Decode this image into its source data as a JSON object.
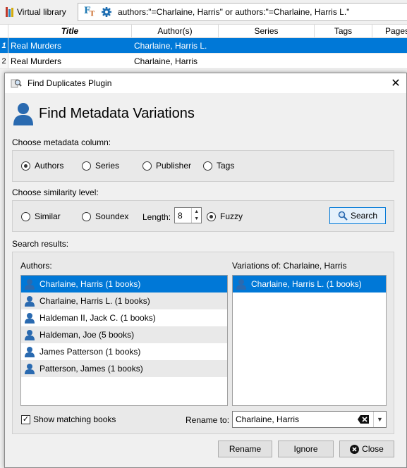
{
  "toolbar": {
    "virtual_library_label": "Virtual library",
    "search_text": "authors:\"=Charlaine, Harris\" or authors:\"=Charlaine, Harris L.\"",
    "ft_icon_main": "F",
    "ft_icon_sub": "T"
  },
  "table": {
    "headers": {
      "title": "Title",
      "authors": "Author(s)",
      "series": "Series",
      "tags": "Tags",
      "pages": "Pages"
    },
    "rows": [
      {
        "num": "1",
        "title": "Real Murders",
        "authors": "Charlaine, Harris L."
      },
      {
        "num": "2",
        "title": "Real Murders",
        "authors": "Charlaine, Harris"
      }
    ]
  },
  "dialog": {
    "window_title": "Find Duplicates Plugin",
    "heading": "Find Metadata Variations",
    "metadata_column_label": "Choose metadata column:",
    "columns": {
      "authors": "Authors",
      "series": "Series",
      "publisher": "Publisher",
      "tags": "Tags"
    },
    "similarity_label": "Choose similarity level:",
    "similarity": {
      "similar": "Similar",
      "soundex": "Soundex",
      "length_label": "Length:",
      "length_value": "8",
      "fuzzy": "Fuzzy"
    },
    "search_button": "Search",
    "results_label": "Search results:",
    "authors_list_label": "Authors:",
    "authors": [
      "Charlaine, Harris (1 books)",
      "Charlaine, Harris L. (1 books)",
      "Haldeman II, Jack C. (1 books)",
      "Haldeman, Joe (5 books)",
      "James Patterson (1 books)",
      "Patterson, James (1 books)"
    ],
    "variations_label": "Variations of: Charlaine, Harris",
    "variations": [
      "Charlaine, Harris L. (1 books)"
    ],
    "show_matching_label": "Show matching books",
    "rename_to_label": "Rename to:",
    "rename_to_value": "Charlaine, Harris",
    "buttons": {
      "rename": "Rename",
      "ignore": "Ignore",
      "close": "Close"
    }
  },
  "colors": {
    "selection": "#0078d7",
    "person_icon": "#2a6ab0",
    "ft_blue": "#1f7ab3"
  }
}
